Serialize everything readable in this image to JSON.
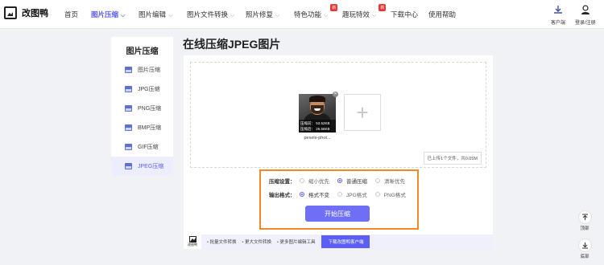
{
  "brand": {
    "name": "改图鸭"
  },
  "nav": {
    "items": [
      {
        "label": "首页",
        "dropdown": false,
        "active": false
      },
      {
        "label": "图片压缩",
        "dropdown": true,
        "active": true
      },
      {
        "label": "图片编辑",
        "dropdown": true,
        "active": false
      },
      {
        "label": "图片文件转换",
        "dropdown": true,
        "active": false
      },
      {
        "label": "照片修复",
        "dropdown": true,
        "active": false
      },
      {
        "label": "特色功能",
        "dropdown": true,
        "active": false,
        "badge": "新"
      },
      {
        "label": "趣玩特效",
        "dropdown": true,
        "active": false,
        "badge": "新"
      },
      {
        "label": "下载中心",
        "dropdown": false,
        "active": false
      },
      {
        "label": "使用帮助",
        "dropdown": false,
        "active": false
      }
    ],
    "client_label": "客户端",
    "login_label": "登录/注册"
  },
  "sidebar": {
    "title": "图片压缩",
    "items": [
      {
        "label": "图片压缩",
        "active": false
      },
      {
        "label": "JPG压缩",
        "active": false
      },
      {
        "label": "PNG压缩",
        "active": false
      },
      {
        "label": "BMP压缩",
        "active": false
      },
      {
        "label": "GIF压缩",
        "active": false
      },
      {
        "label": "JPEG压缩",
        "active": true
      }
    ]
  },
  "main": {
    "title": "在线压缩JPEG图片",
    "file": {
      "name": "pexels-phot...",
      "before": "压缩前：  53.52KB",
      "after": "压缩后：  26.56KB"
    },
    "add_symbol": "+",
    "upload_note": "已上传1个文件，共0.05M",
    "settings": {
      "compress_label": "压缩设置：",
      "compress_options": [
        "缩小优先",
        "普通压缩",
        "清晰优先"
      ],
      "compress_selected": "普通压缩",
      "format_label": "输出格式：",
      "format_options": [
        "格式不变",
        "JPG格式",
        "PNG格式"
      ],
      "format_selected": "格式不变",
      "start_button": "开始压缩"
    }
  },
  "bottom_bar": {
    "logo_label": "改图鸭",
    "links": [
      "批量文件转换",
      "更大文件转换",
      "更多图片编辑工具"
    ],
    "download_button": "下载改图鸭客户端"
  },
  "float": {
    "top_label": "顶部",
    "bottom_label": "底部"
  },
  "colors": {
    "accent": "#5b5ef7",
    "highlight_border": "#f08a24",
    "button": "#6f6ff6"
  }
}
